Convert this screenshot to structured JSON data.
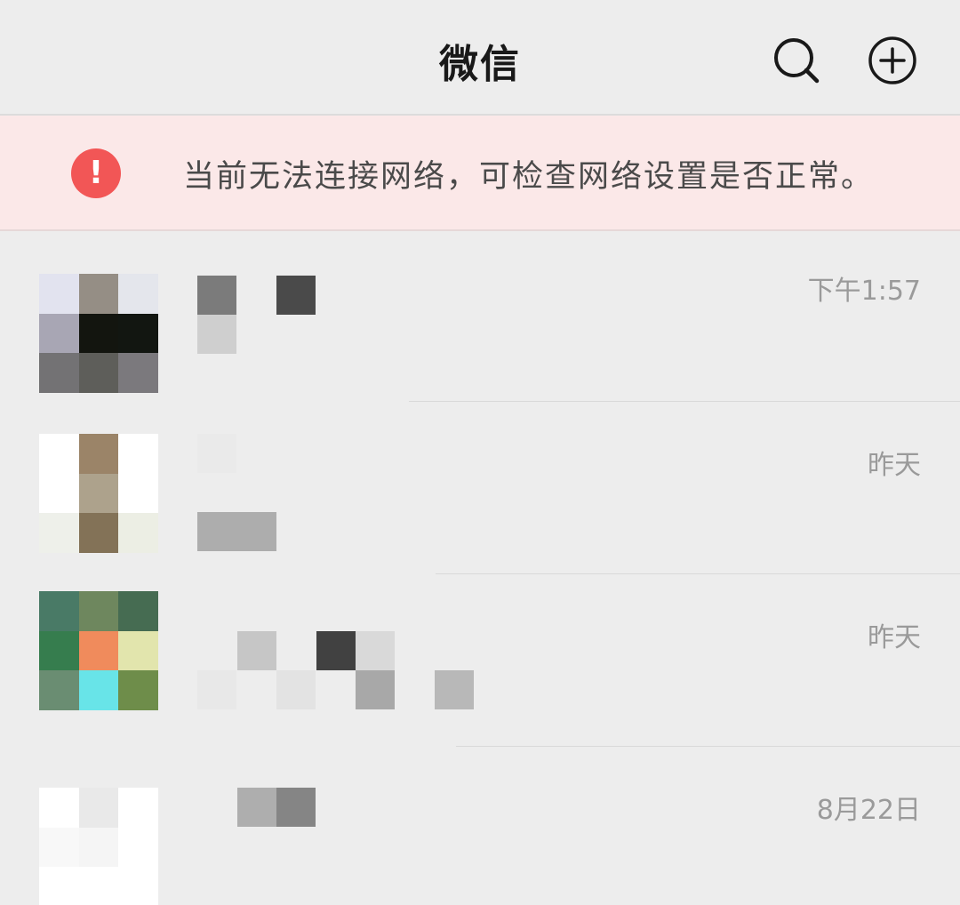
{
  "header": {
    "title": "微信",
    "search_icon": "search-icon",
    "add_icon": "add-circle-icon"
  },
  "alert": {
    "icon": "exclamation-icon",
    "icon_glyph": "!",
    "message": "当前无法连接网络，可检查网络设置是否正常。",
    "color": "#f25656"
  },
  "chats": [
    {
      "time": "下午1:57"
    },
    {
      "time": "昨天"
    },
    {
      "time": "昨天"
    },
    {
      "time": "8月22日"
    }
  ]
}
